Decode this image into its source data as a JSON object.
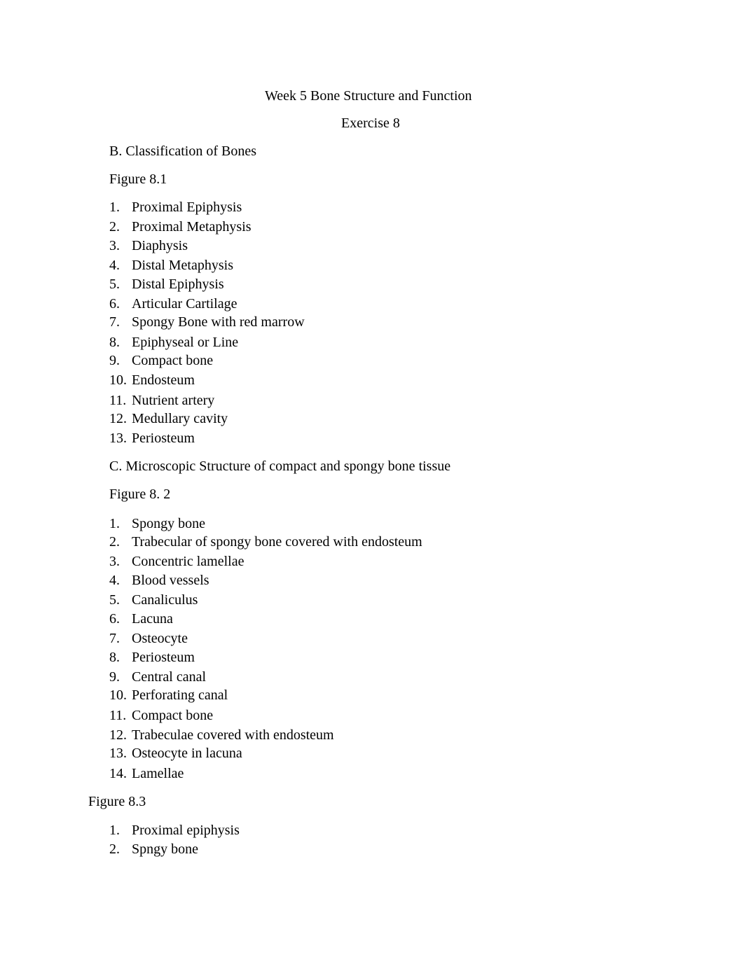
{
  "document": {
    "title": "Week 5 Bone Structure and Function",
    "subtitle": "Exercise 8",
    "sections": [
      {
        "heading": "B. Classification of Bones",
        "figure": "Figure 8.1",
        "items": [
          "Proximal Epiphysis",
          "Proximal Metaphysis",
          "Diaphysis",
          "Distal Metaphysis",
          "Distal Epiphysis",
          "Articular Cartilage",
          "Spongy Bone with red marrow",
          "Epiphyseal or Line",
          "Compact bone",
          "Endosteum",
          "Nutrient artery",
          "Medullary cavity",
          "Periosteum"
        ]
      },
      {
        "heading": "C. Microscopic Structure of compact and spongy bone tissue",
        "figure": "Figure 8. 2",
        "items": [
          "Spongy bone",
          "Trabecular of spongy bone covered with endosteum",
          "Concentric lamellae",
          "Blood vessels",
          "Canaliculus",
          "Lacuna",
          "Osteocyte",
          "Periosteum",
          "Central canal",
          "Perforating canal",
          "Compact bone",
          "Trabeculae covered with endosteum",
          "Osteocyte in lacuna",
          "Lamellae"
        ]
      },
      {
        "figure": "Figure 8.3",
        "items": [
          "Proximal epiphysis",
          "Spngy bone"
        ]
      }
    ]
  }
}
